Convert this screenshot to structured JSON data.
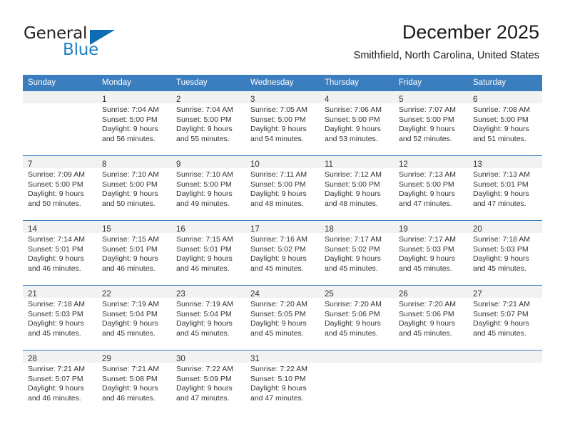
{
  "logo": {
    "word_top": "General",
    "word_bottom": "Blue",
    "triangle_color": "#0d6cb4",
    "text_color": "#231f20",
    "blue_text_color": "#1f7fc4"
  },
  "header": {
    "title": "December 2025",
    "subtitle": "Smithfield, North Carolina, United States",
    "header_bg_color": "#3b7ebf",
    "header_text_color": "#ffffff",
    "daynum_band_color": "#f2f2f2"
  },
  "weekday_headers": [
    "Sunday",
    "Monday",
    "Tuesday",
    "Wednesday",
    "Thursday",
    "Friday",
    "Saturday"
  ],
  "weeks": [
    [
      {
        "day": "",
        "sunrise": "",
        "sunset": "",
        "daylight_line1": "",
        "daylight_line2": ""
      },
      {
        "day": "1",
        "sunrise": "Sunrise: 7:04 AM",
        "sunset": "Sunset: 5:00 PM",
        "daylight_line1": "Daylight: 9 hours",
        "daylight_line2": "and 56 minutes."
      },
      {
        "day": "2",
        "sunrise": "Sunrise: 7:04 AM",
        "sunset": "Sunset: 5:00 PM",
        "daylight_line1": "Daylight: 9 hours",
        "daylight_line2": "and 55 minutes."
      },
      {
        "day": "3",
        "sunrise": "Sunrise: 7:05 AM",
        "sunset": "Sunset: 5:00 PM",
        "daylight_line1": "Daylight: 9 hours",
        "daylight_line2": "and 54 minutes."
      },
      {
        "day": "4",
        "sunrise": "Sunrise: 7:06 AM",
        "sunset": "Sunset: 5:00 PM",
        "daylight_line1": "Daylight: 9 hours",
        "daylight_line2": "and 53 minutes."
      },
      {
        "day": "5",
        "sunrise": "Sunrise: 7:07 AM",
        "sunset": "Sunset: 5:00 PM",
        "daylight_line1": "Daylight: 9 hours",
        "daylight_line2": "and 52 minutes."
      },
      {
        "day": "6",
        "sunrise": "Sunrise: 7:08 AM",
        "sunset": "Sunset: 5:00 PM",
        "daylight_line1": "Daylight: 9 hours",
        "daylight_line2": "and 51 minutes."
      }
    ],
    [
      {
        "day": "7",
        "sunrise": "Sunrise: 7:09 AM",
        "sunset": "Sunset: 5:00 PM",
        "daylight_line1": "Daylight: 9 hours",
        "daylight_line2": "and 50 minutes."
      },
      {
        "day": "8",
        "sunrise": "Sunrise: 7:10 AM",
        "sunset": "Sunset: 5:00 PM",
        "daylight_line1": "Daylight: 9 hours",
        "daylight_line2": "and 50 minutes."
      },
      {
        "day": "9",
        "sunrise": "Sunrise: 7:10 AM",
        "sunset": "Sunset: 5:00 PM",
        "daylight_line1": "Daylight: 9 hours",
        "daylight_line2": "and 49 minutes."
      },
      {
        "day": "10",
        "sunrise": "Sunrise: 7:11 AM",
        "sunset": "Sunset: 5:00 PM",
        "daylight_line1": "Daylight: 9 hours",
        "daylight_line2": "and 48 minutes."
      },
      {
        "day": "11",
        "sunrise": "Sunrise: 7:12 AM",
        "sunset": "Sunset: 5:00 PM",
        "daylight_line1": "Daylight: 9 hours",
        "daylight_line2": "and 48 minutes."
      },
      {
        "day": "12",
        "sunrise": "Sunrise: 7:13 AM",
        "sunset": "Sunset: 5:00 PM",
        "daylight_line1": "Daylight: 9 hours",
        "daylight_line2": "and 47 minutes."
      },
      {
        "day": "13",
        "sunrise": "Sunrise: 7:13 AM",
        "sunset": "Sunset: 5:01 PM",
        "daylight_line1": "Daylight: 9 hours",
        "daylight_line2": "and 47 minutes."
      }
    ],
    [
      {
        "day": "14",
        "sunrise": "Sunrise: 7:14 AM",
        "sunset": "Sunset: 5:01 PM",
        "daylight_line1": "Daylight: 9 hours",
        "daylight_line2": "and 46 minutes."
      },
      {
        "day": "15",
        "sunrise": "Sunrise: 7:15 AM",
        "sunset": "Sunset: 5:01 PM",
        "daylight_line1": "Daylight: 9 hours",
        "daylight_line2": "and 46 minutes."
      },
      {
        "day": "16",
        "sunrise": "Sunrise: 7:15 AM",
        "sunset": "Sunset: 5:01 PM",
        "daylight_line1": "Daylight: 9 hours",
        "daylight_line2": "and 46 minutes."
      },
      {
        "day": "17",
        "sunrise": "Sunrise: 7:16 AM",
        "sunset": "Sunset: 5:02 PM",
        "daylight_line1": "Daylight: 9 hours",
        "daylight_line2": "and 45 minutes."
      },
      {
        "day": "18",
        "sunrise": "Sunrise: 7:17 AM",
        "sunset": "Sunset: 5:02 PM",
        "daylight_line1": "Daylight: 9 hours",
        "daylight_line2": "and 45 minutes."
      },
      {
        "day": "19",
        "sunrise": "Sunrise: 7:17 AM",
        "sunset": "Sunset: 5:03 PM",
        "daylight_line1": "Daylight: 9 hours",
        "daylight_line2": "and 45 minutes."
      },
      {
        "day": "20",
        "sunrise": "Sunrise: 7:18 AM",
        "sunset": "Sunset: 5:03 PM",
        "daylight_line1": "Daylight: 9 hours",
        "daylight_line2": "and 45 minutes."
      }
    ],
    [
      {
        "day": "21",
        "sunrise": "Sunrise: 7:18 AM",
        "sunset": "Sunset: 5:03 PM",
        "daylight_line1": "Daylight: 9 hours",
        "daylight_line2": "and 45 minutes."
      },
      {
        "day": "22",
        "sunrise": "Sunrise: 7:19 AM",
        "sunset": "Sunset: 5:04 PM",
        "daylight_line1": "Daylight: 9 hours",
        "daylight_line2": "and 45 minutes."
      },
      {
        "day": "23",
        "sunrise": "Sunrise: 7:19 AM",
        "sunset": "Sunset: 5:04 PM",
        "daylight_line1": "Daylight: 9 hours",
        "daylight_line2": "and 45 minutes."
      },
      {
        "day": "24",
        "sunrise": "Sunrise: 7:20 AM",
        "sunset": "Sunset: 5:05 PM",
        "daylight_line1": "Daylight: 9 hours",
        "daylight_line2": "and 45 minutes."
      },
      {
        "day": "25",
        "sunrise": "Sunrise: 7:20 AM",
        "sunset": "Sunset: 5:06 PM",
        "daylight_line1": "Daylight: 9 hours",
        "daylight_line2": "and 45 minutes."
      },
      {
        "day": "26",
        "sunrise": "Sunrise: 7:20 AM",
        "sunset": "Sunset: 5:06 PM",
        "daylight_line1": "Daylight: 9 hours",
        "daylight_line2": "and 45 minutes."
      },
      {
        "day": "27",
        "sunrise": "Sunrise: 7:21 AM",
        "sunset": "Sunset: 5:07 PM",
        "daylight_line1": "Daylight: 9 hours",
        "daylight_line2": "and 45 minutes."
      }
    ],
    [
      {
        "day": "28",
        "sunrise": "Sunrise: 7:21 AM",
        "sunset": "Sunset: 5:07 PM",
        "daylight_line1": "Daylight: 9 hours",
        "daylight_line2": "and 46 minutes."
      },
      {
        "day": "29",
        "sunrise": "Sunrise: 7:21 AM",
        "sunset": "Sunset: 5:08 PM",
        "daylight_line1": "Daylight: 9 hours",
        "daylight_line2": "and 46 minutes."
      },
      {
        "day": "30",
        "sunrise": "Sunrise: 7:22 AM",
        "sunset": "Sunset: 5:09 PM",
        "daylight_line1": "Daylight: 9 hours",
        "daylight_line2": "and 47 minutes."
      },
      {
        "day": "31",
        "sunrise": "Sunrise: 7:22 AM",
        "sunset": "Sunset: 5:10 PM",
        "daylight_line1": "Daylight: 9 hours",
        "daylight_line2": "and 47 minutes."
      },
      {
        "day": "",
        "sunrise": "",
        "sunset": "",
        "daylight_line1": "",
        "daylight_line2": ""
      },
      {
        "day": "",
        "sunrise": "",
        "sunset": "",
        "daylight_line1": "",
        "daylight_line2": ""
      },
      {
        "day": "",
        "sunrise": "",
        "sunset": "",
        "daylight_line1": "",
        "daylight_line2": ""
      }
    ]
  ]
}
